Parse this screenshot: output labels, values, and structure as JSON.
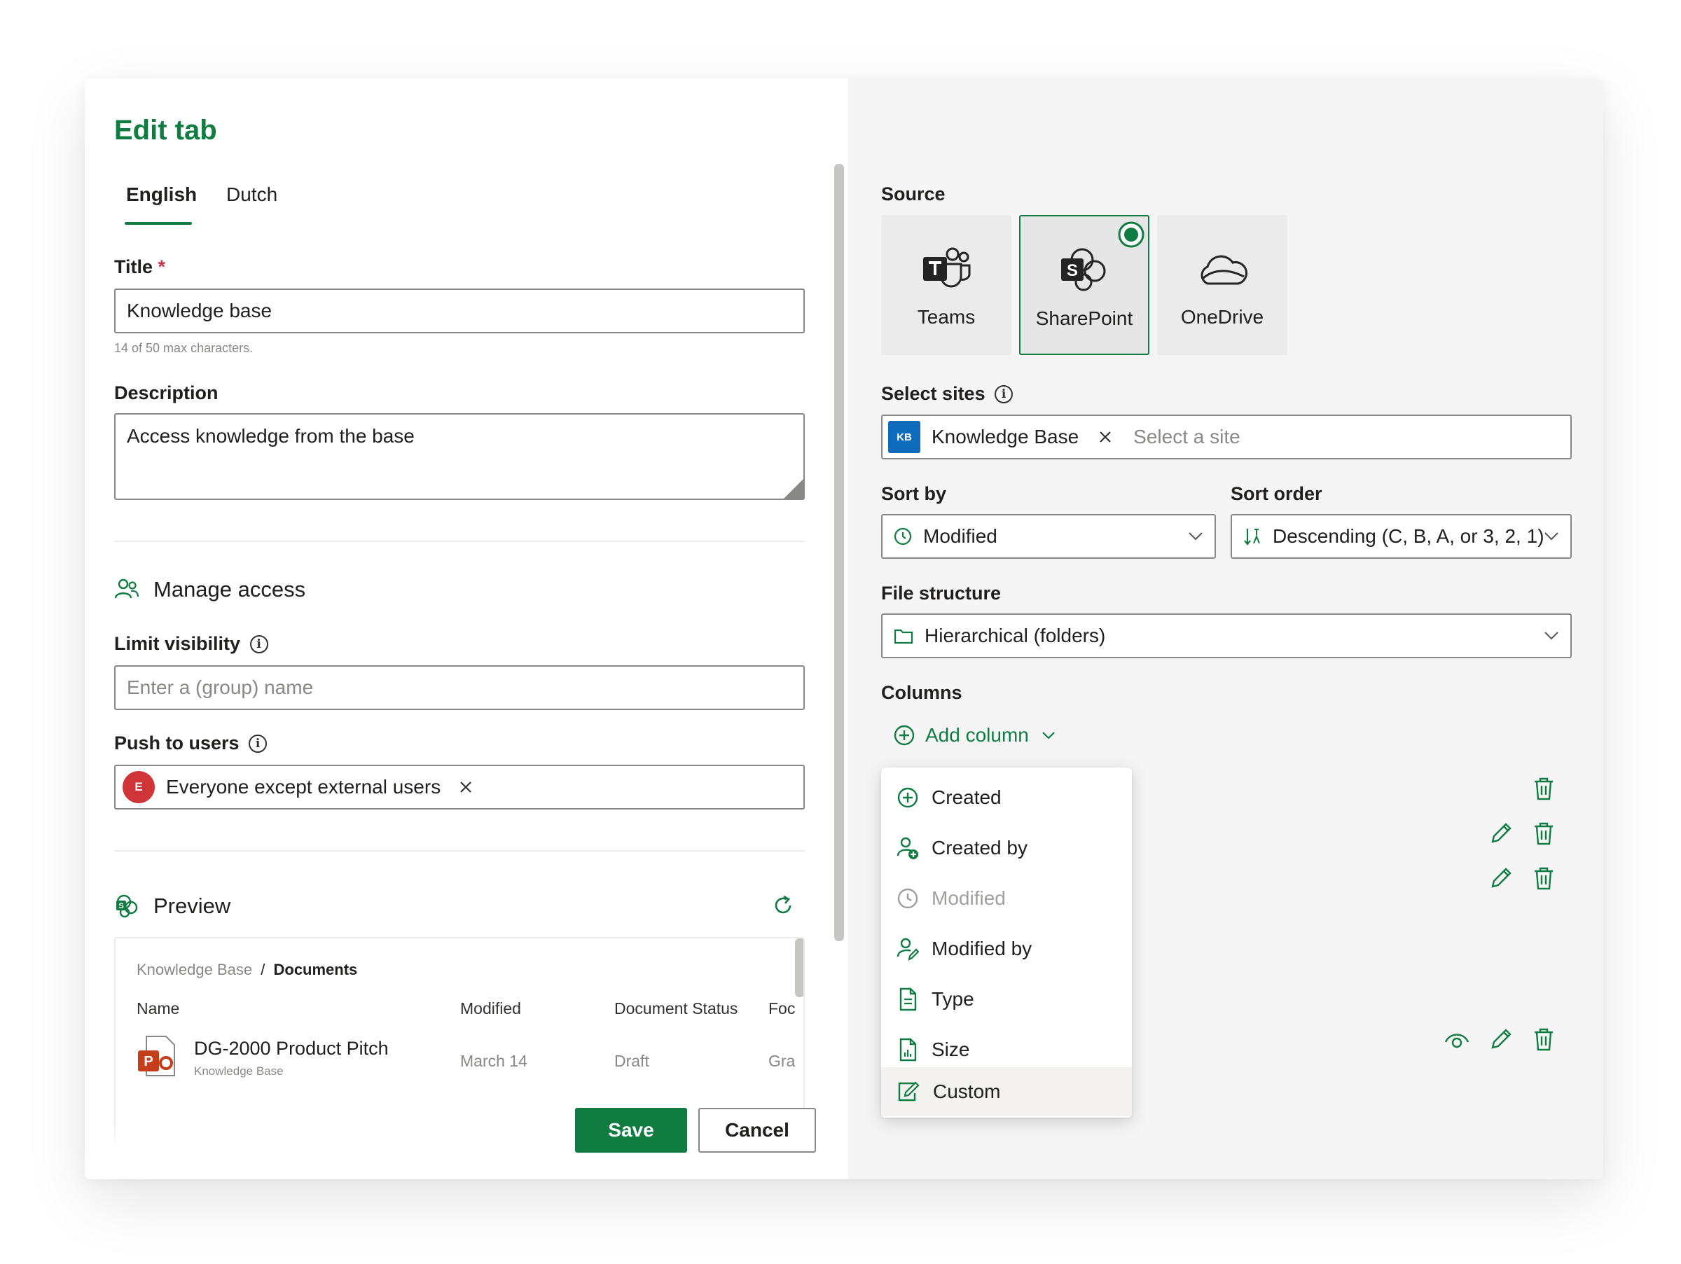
{
  "dialog": {
    "title": "Edit tab",
    "tabs": [
      {
        "label": "English",
        "active": true
      },
      {
        "label": "Dutch",
        "active": false
      }
    ],
    "title_field": {
      "label": "Title",
      "required_mark": "*",
      "value": "Knowledge base",
      "hint": "14 of 50 max characters."
    },
    "description_field": {
      "label": "Description",
      "value": "Access knowledge from the base"
    },
    "manage_access": {
      "heading": "Manage access",
      "limit_visibility": {
        "label": "Limit visibility",
        "placeholder": "Enter a (group) name"
      },
      "push_to_users": {
        "label": "Push to users",
        "chip_initial": "E",
        "chip_label": "Everyone except external users"
      }
    },
    "preview": {
      "heading": "Preview",
      "breadcrumb_site": "Knowledge Base",
      "breadcrumb_sep": "/",
      "breadcrumb_folder": "Documents",
      "columns": [
        "Name",
        "Modified",
        "Document Status",
        "Foc"
      ],
      "rows": [
        {
          "name": "DG-2000 Product Pitch",
          "location": "Knowledge Base",
          "modified": "March 14",
          "status": "Draft",
          "extra": "Gra",
          "icon_letter": "P"
        }
      ]
    },
    "actions": {
      "save_label": "Save",
      "cancel_label": "Cancel"
    }
  },
  "settings": {
    "source": {
      "label": "Source",
      "options": [
        {
          "label": "Teams",
          "selected": false
        },
        {
          "label": "SharePoint",
          "selected": true
        },
        {
          "label": "OneDrive",
          "selected": false
        }
      ]
    },
    "select_sites": {
      "label": "Select sites",
      "chip_initials": "KB",
      "chip_label": "Knowledge Base",
      "placeholder": "Select a site"
    },
    "sort_by": {
      "label": "Sort by",
      "value": "Modified"
    },
    "sort_order": {
      "label": "Sort order",
      "value": "Descending (C, B, A, or 3, 2, 1)"
    },
    "file_structure": {
      "label": "File structure",
      "value": "Hierarchical (folders)"
    },
    "columns": {
      "label": "Columns",
      "add_column_label": "Add column"
    },
    "column_menu": {
      "items": [
        {
          "label": "Created",
          "icon": "add-circle-icon",
          "disabled": false
        },
        {
          "label": "Created by",
          "icon": "person-add-icon",
          "disabled": false
        },
        {
          "label": "Modified",
          "icon": "clock-icon",
          "disabled": true
        },
        {
          "label": "Modified by",
          "icon": "person-edit-icon",
          "disabled": false
        },
        {
          "label": "Type",
          "icon": "document-icon",
          "disabled": false
        },
        {
          "label": "Size",
          "icon": "document-data-icon",
          "disabled": false
        },
        {
          "label": "Custom",
          "icon": "note-edit-icon",
          "disabled": false
        }
      ]
    }
  },
  "colors": {
    "brand_green": "#107c41",
    "accent_blue": "#0f6cbd",
    "avatar_red": "#d13438"
  }
}
